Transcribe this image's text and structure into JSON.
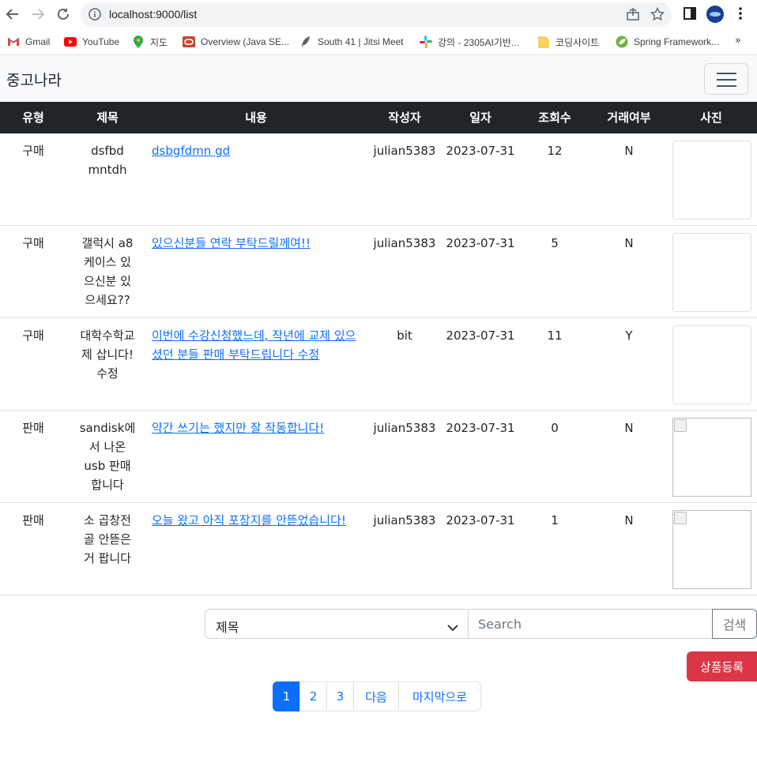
{
  "browser": {
    "url": "localhost:9000/list",
    "bookmarks": [
      {
        "label": "Gmail",
        "icon": "gmail-icon"
      },
      {
        "label": "YouTube",
        "icon": "youtube-icon"
      },
      {
        "label": "지도",
        "icon": "maps-icon"
      },
      {
        "label": "Overview (Java SE...",
        "icon": "oracle-icon"
      },
      {
        "label": "South 41 | Jitsi Meet",
        "icon": "feather-icon"
      },
      {
        "label": "강의 - 2305AI기반...",
        "icon": "slack-icon"
      },
      {
        "label": "코딩사이트",
        "icon": "folder-icon"
      },
      {
        "label": "Spring Framework...",
        "icon": "spring-icon"
      }
    ],
    "more": "»"
  },
  "navbar": {
    "brand": "중고나라"
  },
  "table": {
    "headers": [
      "유형",
      "제목",
      "내용",
      "작성자",
      "일자",
      "조회수",
      "거래여부",
      "사진"
    ],
    "rows": [
      {
        "type": "구매",
        "title": "dsfbd mntdh",
        "content": "dsbgfdmn gd",
        "author": "julian5383",
        "date": "2023-07-31",
        "views": "12",
        "traded": "N",
        "photo": "empty"
      },
      {
        "type": "구매",
        "title": "갤럭시 a8 케이스 있으신분 있으세요??",
        "content": "있으신분들 연락 부탁드릴께여!!",
        "author": "julian5383",
        "date": "2023-07-31",
        "views": "5",
        "traded": "N",
        "photo": "empty"
      },
      {
        "type": "구매",
        "title": "대학수학교제 삽니다! 수정",
        "content": "이번에 수강신청했느데, 작년에 교제 있으셨던 분들 판매 부탁드립니다 수정",
        "author": "bit",
        "date": "2023-07-31",
        "views": "11",
        "traded": "Y",
        "photo": "empty"
      },
      {
        "type": "판매",
        "title": "sandisk에서 나온 usb 판매합니다",
        "content": "약간 쓰기는 했지만 잘 작동합니다!",
        "author": "julian5383",
        "date": "2023-07-31",
        "views": "0",
        "traded": "N",
        "photo": "broken"
      },
      {
        "type": "판매",
        "title": "소 곱창전골 안뜯은거 팝니다",
        "content": "오늘 왔고 아직 포장지를 안뜯었습니다!",
        "author": "julian5383",
        "date": "2023-07-31",
        "views": "1",
        "traded": "N",
        "photo": "broken"
      }
    ]
  },
  "search": {
    "selected": "제목",
    "placeholder": "Search",
    "button": "검색"
  },
  "register_button": "상품등록",
  "pagination": [
    "1",
    "2",
    "3",
    "다음",
    "마지막으로"
  ],
  "colors": {
    "header_bg": "#212529",
    "link": "#0d6efd",
    "danger": "#dc3545",
    "navbar_bg": "#f8f9fa"
  }
}
